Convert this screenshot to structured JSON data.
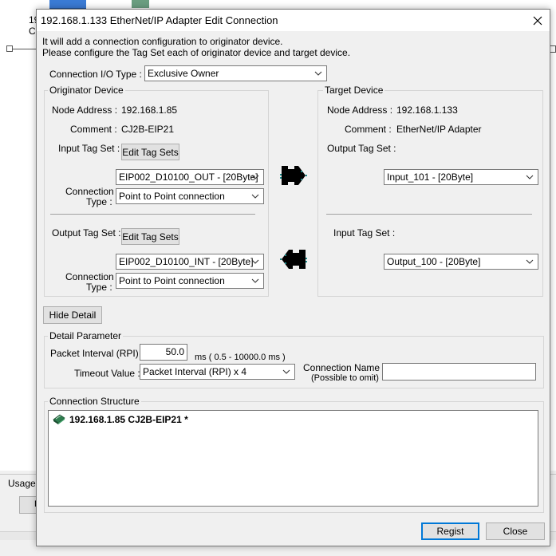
{
  "background": {
    "top_label": "19\nC",
    "usage_label": "Usage o",
    "left_button": "D"
  },
  "dialog": {
    "title": "192.168.1.133 EtherNet/IP Adapter Edit Connection",
    "close_icon": "close-icon",
    "intro_line1": "It will add a connection configuration to originator device.",
    "intro_line2": "Please configure the Tag Set each of originator device and target device.",
    "io_type_label": "Connection I/O Type :",
    "io_type_value": "Exclusive Owner",
    "originator": {
      "legend": "Originator Device",
      "node_address_label": "Node Address :",
      "node_address": "192.168.1.85",
      "comment_label": "Comment :",
      "comment": "CJ2B-EIP21",
      "input_tag_set_label": "Input Tag Set :",
      "edit_tag_sets_label": "Edit Tag Sets",
      "input_tag_value": "EIP002_D10100_OUT - [20Byte]",
      "connection_type_label1": "Connection",
      "connection_type_label2": "Type :",
      "connection_type_value": "Point to Point connection",
      "output_tag_set_label": "Output Tag Set :",
      "edit_tag_sets_label2": "Edit Tag Sets",
      "output_tag_value": "EIP002_D10100_INT - [20Byte]",
      "connection_type2_label1": "Connection",
      "connection_type2_label2": "Type :",
      "connection_type2_value": "Point to Point connection"
    },
    "target": {
      "legend": "Target Device",
      "node_address_label": "Node Address :",
      "node_address": "192.168.1.133",
      "comment_label": "Comment :",
      "comment": "EtherNet/IP Adapter",
      "output_tag_set_label": "Output Tag Set :",
      "output_tag_value": "Input_101 - [20Byte]",
      "input_tag_set_label": "Input Tag Set :",
      "input_tag_value": "Output_100 - [20Byte]"
    },
    "hide_detail_label": "Hide Detail",
    "detail": {
      "legend": "Detail Parameter",
      "packet_interval_label": "Packet Interval (RPI) :",
      "packet_interval_value": "50.0",
      "packet_interval_range": "ms ( 0.5 - 10000.0 ms )",
      "timeout_label": "Timeout Value :",
      "timeout_value": "Packet Interval (RPI) x 4",
      "connection_name_label1": "Connection Name :",
      "connection_name_label2": "(Possible to omit)",
      "connection_name_value": ""
    },
    "structure": {
      "legend": "Connection Structure",
      "tree_item": "192.168.1.85 CJ2B-EIP21 *"
    },
    "regist_label": "Regist",
    "close_label": "Close"
  },
  "colors": {
    "dialog_bg": "#f0f0f0",
    "accent": "#0078d7",
    "arrow_fill": "#000000",
    "arrow_dots": "#1a8a8a"
  }
}
